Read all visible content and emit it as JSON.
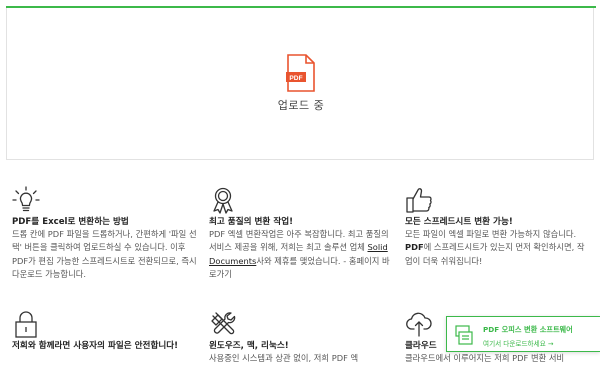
{
  "upload": {
    "status_label": "업로드 중",
    "file_type_badge": "PDF"
  },
  "features": [
    {
      "icon": "lightbulb-icon",
      "title": "PDF를 Excel로 변환하는 방법",
      "body": "드롭 칸에 PDF 파일을 드롭하거나, 간편하게 '파일 선택' 버튼을 클릭하여 업로드하실 수 있습니다. 이후 PDF가 편집 가능한 스프레드시트로 전환되므로, 즉시 다운로드 가능합니다."
    },
    {
      "icon": "award-ribbon-icon",
      "title": "최고 품질의 변환 작업!",
      "body_before": "PDF 엑셀 변환작업은 아주 복잡합니다. 최고 품질의 서비스 제공을 위해, 저희는 최고 솔루션 업체 ",
      "body_link": "Solid Documents",
      "body_after": "사와 제휴를 맺었습니다. - 홈페이지 바로가기"
    },
    {
      "icon": "thumbs-up-icon",
      "title": "모든 스프레드시트 변환 가능!",
      "body_before": "모든 파일이 엑셀 파일로 변환 가능하지 않습니다. ",
      "body_bold": "PDF",
      "body_after": "에 스프레드시트가 있는지 먼저 확인하시면, 작업이 더욱 쉬워집니다!"
    },
    {
      "icon": "lock-icon",
      "title": "저희와 함께라면 사용자의 파일은 안전합니다!"
    },
    {
      "icon": "tools-icon",
      "title": "윈도우즈, 맥, 리눅스!",
      "body": "사용중인 시스템과 상관 없이, 저희 PDF 엑"
    },
    {
      "icon": "cloud-upload-icon",
      "title": "클라우드",
      "body": "클라우드에서 이루어지는 저희 PDF 변환 서비"
    }
  ],
  "promo": {
    "title": "PDF 오피스 변환 소프트웨어",
    "link": "여기서 다운로드하세요 →"
  },
  "colors": {
    "accent": "#3cb94a",
    "pdf_red": "#e9542f"
  }
}
